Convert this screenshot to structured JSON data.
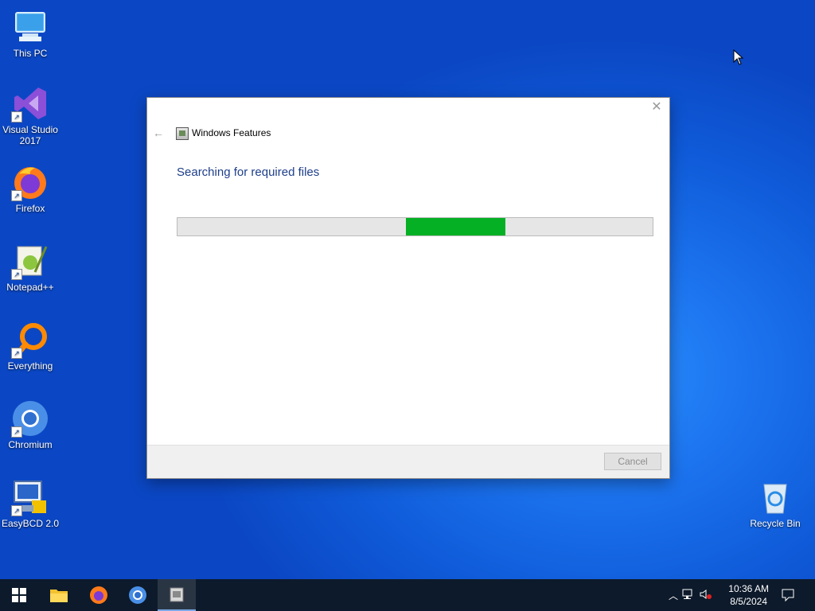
{
  "desktop": {
    "icons": [
      {
        "label": "This PC"
      },
      {
        "label": "Visual Studio 2017"
      },
      {
        "label": "Firefox"
      },
      {
        "label": "Notepad++"
      },
      {
        "label": "Everything"
      },
      {
        "label": "Chromium"
      },
      {
        "label": "EasyBCD 2.0"
      },
      {
        "label": "Recycle Bin"
      }
    ]
  },
  "dialog": {
    "title": "Windows Features",
    "heading": "Searching for required files",
    "progress_segment": {
      "start": 0.48,
      "end": 0.69
    },
    "cancel_label": "Cancel"
  },
  "taskbar": {
    "apps": [
      "windows-start-icon",
      "file-explorer-icon",
      "firefox-icon",
      "chromium-icon",
      "windows-features-icon"
    ],
    "time": "10:36 AM",
    "date": "8/5/2024"
  }
}
